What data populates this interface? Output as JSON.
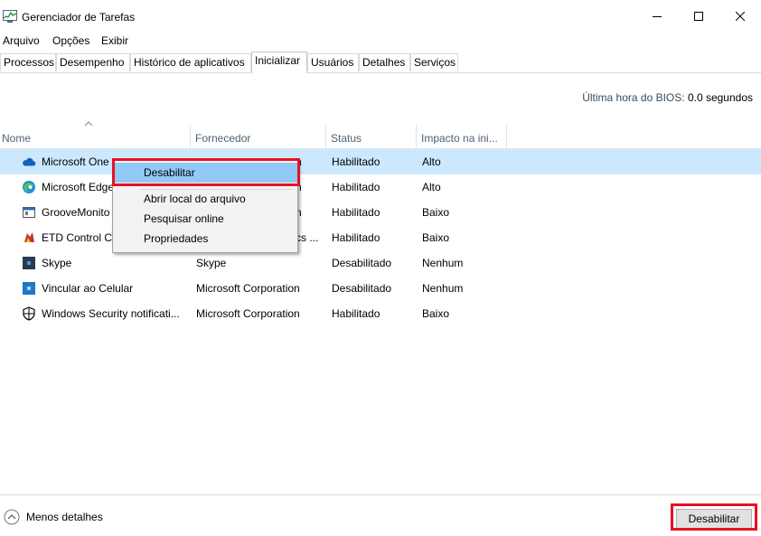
{
  "window": {
    "title": "Gerenciador de Tarefas"
  },
  "menu": [
    "Arquivo",
    "Opções",
    "Exibir"
  ],
  "tabs": [
    "Processos",
    "Desempenho",
    "Histórico de aplicativos",
    "Inicializar",
    "Usuários",
    "Detalhes",
    "Serviços"
  ],
  "active_tab": "Inicializar",
  "bios": {
    "label": "Última hora do BIOS:",
    "value": "0.0 segundos"
  },
  "columns": [
    "Nome",
    "Fornecedor",
    "Status",
    "Impacto na ini..."
  ],
  "rows": [
    {
      "name": "Microsoft One",
      "vendor": "n",
      "status": "Habilitado",
      "impact": "Alto",
      "icon": "onedrive-icon"
    },
    {
      "name": "Microsoft Edge",
      "vendor": "n",
      "status": "Habilitado",
      "impact": "Alto",
      "icon": "edge-icon"
    },
    {
      "name": "GrooveMonito",
      "vendor": "n",
      "status": "Habilitado",
      "impact": "Baixo",
      "icon": "groove-icon"
    },
    {
      "name": "ETD Control Ce",
      "vendor": "cs ...",
      "status": "Habilitado",
      "impact": "Baixo",
      "icon": "etd-icon"
    },
    {
      "name": "Skype",
      "vendor": "Skype",
      "status": "Desabilitado",
      "impact": "Nenhum",
      "icon": "skype-icon"
    },
    {
      "name": "Vincular ao Celular",
      "vendor": "Microsoft Corporation",
      "status": "Desabilitado",
      "impact": "Nenhum",
      "icon": "phone-link-icon"
    },
    {
      "name": "Windows Security notificati...",
      "vendor": "Microsoft Corporation",
      "status": "Habilitado",
      "impact": "Baixo",
      "icon": "shield-icon"
    }
  ],
  "context_menu": [
    "Desabilitar",
    "Abrir local do arquivo",
    "Pesquisar online",
    "Propriedades"
  ],
  "footer": {
    "less_details": "Menos detalhes",
    "disable_button": "Desabilitar"
  },
  "colors": {
    "selection": "#cce8ff",
    "menu_highlight": "#91c9f7",
    "annotation_red": "#e81123"
  }
}
